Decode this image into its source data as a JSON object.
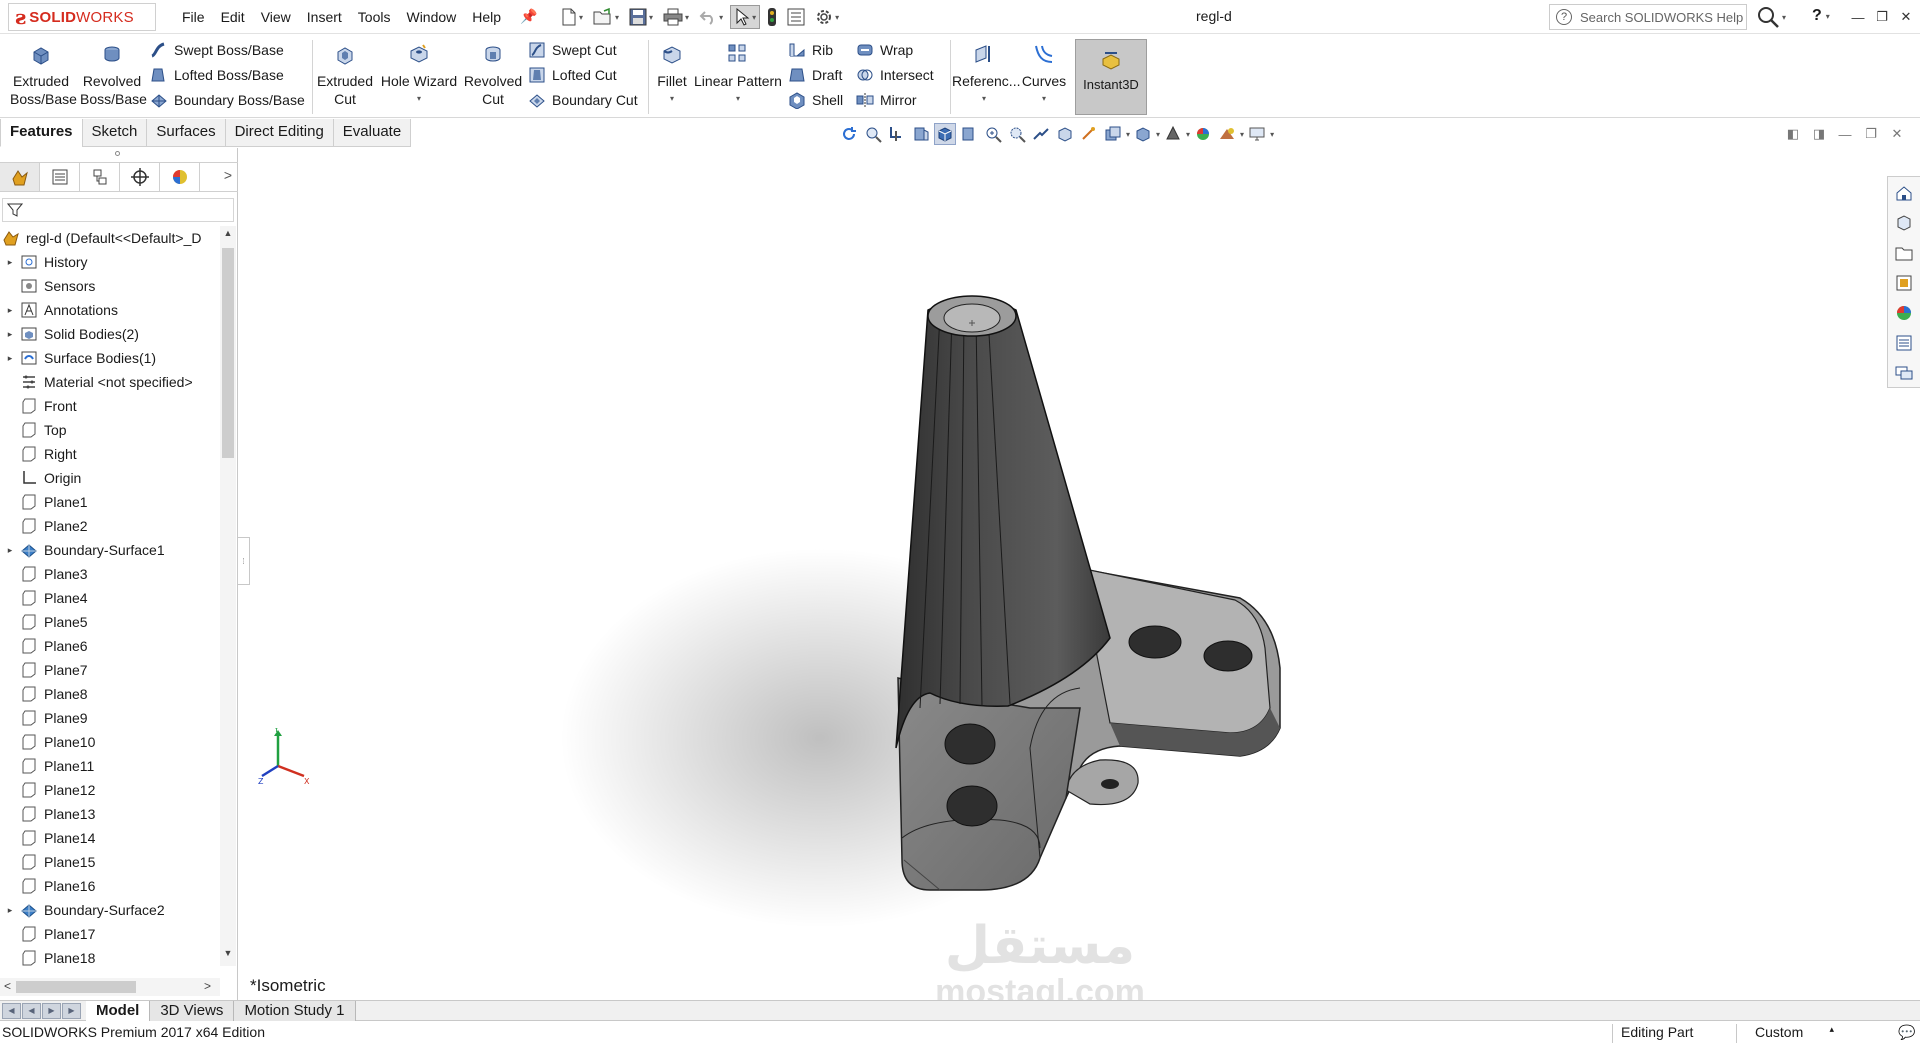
{
  "app": {
    "brand_prefix": "SOLID",
    "brand_suffix": "WORKS",
    "document_title": "regl-d",
    "search_placeholder": "Search SOLIDWORKS Help",
    "help_label": "?"
  },
  "menus": [
    "File",
    "Edit",
    "View",
    "Insert",
    "Tools",
    "Window",
    "Help"
  ],
  "ribbon": {
    "extruded_boss": [
      "Extruded",
      "Boss/Base"
    ],
    "revolved_boss": [
      "Revolved",
      "Boss/Base"
    ],
    "swept_boss": "Swept Boss/Base",
    "lofted_boss": "Lofted Boss/Base",
    "boundary_boss": "Boundary Boss/Base",
    "extruded_cut": [
      "Extruded",
      "Cut"
    ],
    "hole_wizard": "Hole Wizard",
    "revolved_cut": [
      "Revolved",
      "Cut"
    ],
    "swept_cut": "Swept Cut",
    "lofted_cut": "Lofted Cut",
    "boundary_cut": "Boundary Cut",
    "fillet": "Fillet",
    "linear_pattern": "Linear Pattern",
    "rib": "Rib",
    "draft": "Draft",
    "shell": "Shell",
    "wrap": "Wrap",
    "intersect": "Intersect",
    "mirror": "Mirror",
    "reference": "Referenc...",
    "curves": "Curves",
    "instant3d": "Instant3D"
  },
  "command_tabs": [
    {
      "label": "Features",
      "active": true
    },
    {
      "label": "Sketch",
      "active": false
    },
    {
      "label": "Surfaces",
      "active": false
    },
    {
      "label": "Direct Editing",
      "active": false
    },
    {
      "label": "Evaluate",
      "active": false
    }
  ],
  "tree": {
    "root": "regl-d  (Default<<Default>_D",
    "items": [
      {
        "label": "History",
        "icon": "folder-history-icon",
        "expandable": true
      },
      {
        "label": "Sensors",
        "icon": "sensor-icon",
        "expandable": false
      },
      {
        "label": "Annotations",
        "icon": "annotation-icon",
        "expandable": true
      },
      {
        "label": "Solid Bodies(2)",
        "icon": "solid-body-folder-icon",
        "expandable": true
      },
      {
        "label": "Surface Bodies(1)",
        "icon": "surface-body-folder-icon",
        "expandable": true
      },
      {
        "label": "Material <not specified>",
        "icon": "material-icon",
        "expandable": false
      },
      {
        "label": "Front",
        "icon": "plane-icon",
        "expandable": false
      },
      {
        "label": "Top",
        "icon": "plane-icon",
        "expandable": false
      },
      {
        "label": "Right",
        "icon": "plane-icon",
        "expandable": false
      },
      {
        "label": "Origin",
        "icon": "origin-icon",
        "expandable": false
      },
      {
        "label": "Plane1",
        "icon": "plane-icon",
        "expandable": false
      },
      {
        "label": "Plane2",
        "icon": "plane-icon",
        "expandable": false
      },
      {
        "label": "Boundary-Surface1",
        "icon": "boundary-surface-icon",
        "expandable": true
      },
      {
        "label": "Plane3",
        "icon": "plane-icon",
        "expandable": false
      },
      {
        "label": "Plane4",
        "icon": "plane-icon",
        "expandable": false
      },
      {
        "label": "Plane5",
        "icon": "plane-icon",
        "expandable": false
      },
      {
        "label": "Plane6",
        "icon": "plane-icon",
        "expandable": false
      },
      {
        "label": "Plane7",
        "icon": "plane-icon",
        "expandable": false
      },
      {
        "label": "Plane8",
        "icon": "plane-icon",
        "expandable": false
      },
      {
        "label": "Plane9",
        "icon": "plane-icon",
        "expandable": false
      },
      {
        "label": "Plane10",
        "icon": "plane-icon",
        "expandable": false
      },
      {
        "label": "Plane11",
        "icon": "plane-icon",
        "expandable": false
      },
      {
        "label": "Plane12",
        "icon": "plane-icon",
        "expandable": false
      },
      {
        "label": "Plane13",
        "icon": "plane-icon",
        "expandable": false
      },
      {
        "label": "Plane14",
        "icon": "plane-icon",
        "expandable": false
      },
      {
        "label": "Plane15",
        "icon": "plane-icon",
        "expandable": false
      },
      {
        "label": "Plane16",
        "icon": "plane-icon",
        "expandable": false
      },
      {
        "label": "Boundary-Surface2",
        "icon": "boundary-surface-icon",
        "expandable": true
      },
      {
        "label": "Plane17",
        "icon": "plane-icon",
        "expandable": false
      },
      {
        "label": "Plane18",
        "icon": "plane-icon",
        "expandable": false
      }
    ]
  },
  "viewport": {
    "view_name": "*Isometric",
    "watermark_arabic": "مستقل",
    "watermark_latin": "mostaql.com"
  },
  "bottom_tabs": [
    {
      "label": "Model",
      "active": true
    },
    {
      "label": "3D Views",
      "active": false
    },
    {
      "label": "Motion Study 1",
      "active": false
    }
  ],
  "status": {
    "edition": "SOLIDWORKS Premium 2017 x64 Edition",
    "mode": "Editing Part",
    "units": "Custom"
  },
  "colors": {
    "brand_red": "#d52b1e",
    "accent_blue": "#2c6fd3",
    "model_gray": "#7a7a7a"
  }
}
